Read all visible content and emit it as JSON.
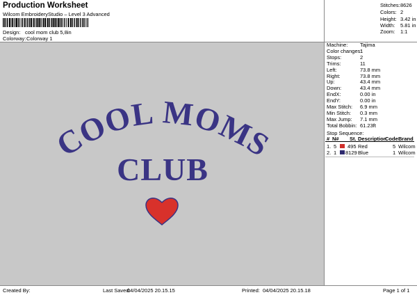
{
  "header": {
    "title": "Production Worksheet",
    "subtitle": "Wilcom EmbroideryStudio – Level 3 Advanced"
  },
  "design": {
    "design_label": "Design:",
    "design_value": "cool mom club 5,8in",
    "colorway_label": "Colorway:",
    "colorway_value": "Colorway 1"
  },
  "stats": [
    {
      "label": "Stitches:",
      "value": "8626"
    },
    {
      "label": "Colors:",
      "value": "2"
    },
    {
      "label": "Height:",
      "value": "3.42 in"
    },
    {
      "label": "Width:",
      "value": "5.81 in"
    },
    {
      "label": "Zoom:",
      "value": "1:1"
    }
  ],
  "machine": [
    {
      "label": "Machine:",
      "value": "Tajima"
    },
    {
      "label": "Color changes:",
      "value": "1"
    },
    {
      "label": "Stops:",
      "value": "2"
    },
    {
      "label": "Trims:",
      "value": "11"
    },
    {
      "label": "Left:",
      "value": "73.8 mm"
    },
    {
      "label": "Right:",
      "value": "73.8 mm"
    },
    {
      "label": "Up:",
      "value": "43.4 mm"
    },
    {
      "label": "Down:",
      "value": "43.4 mm"
    },
    {
      "label": "EndX:",
      "value": "0.00 in"
    },
    {
      "label": "EndY:",
      "value": "0.00 in"
    },
    {
      "label": "Max Stitch:",
      "value": "6.9 mm"
    },
    {
      "label": "Min Stitch:",
      "value": "0.3 mm"
    },
    {
      "label": "Max Jump:",
      "value": "7.1 mm"
    },
    {
      "label": "Total Bobbin:",
      "value": "61.23ft"
    }
  ],
  "sequence": {
    "title": "Stop Sequence:",
    "headers": [
      "#",
      "N#",
      "St.",
      "Description",
      "Code",
      "Brand"
    ],
    "rows": [
      {
        "num": "1.",
        "n": "5",
        "color": "#d0302b",
        "st": "495",
        "desc": "Red",
        "code": "5",
        "brand": "Wilcom"
      },
      {
        "num": "2.",
        "n": "1",
        "color": "#2e2a6e",
        "st": "8129",
        "desc": "Blue",
        "code": "1",
        "brand": "Wilcom"
      }
    ]
  },
  "artwork": {
    "line1": "COOL MOMS",
    "line2": "CLUB",
    "text_color": "#3a3484",
    "heart_color": "#d8312b",
    "heart_outline": "#3a3484",
    "background": "#c8c8c8"
  },
  "footer": {
    "created_label": "Created By:",
    "saved_label": "Last Saved:",
    "saved_value": "04/04/2025 20.15.15",
    "printed_label": "Printed:",
    "printed_value": "04/04/2025 20.15.18",
    "page": "Page 1 of 1"
  }
}
